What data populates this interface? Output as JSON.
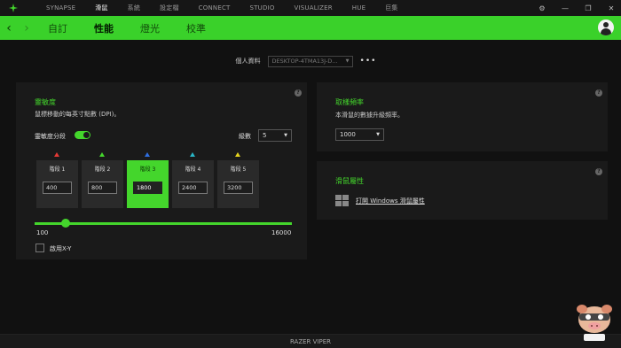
{
  "titlebar": {
    "nav": [
      "SYNAPSE",
      "滑鼠",
      "系統",
      "設定檔",
      "CONNECT",
      "STUDIO",
      "VISUALIZER",
      "HUE",
      "巨集"
    ],
    "active_index": 1
  },
  "subnav": {
    "tabs": [
      "自訂",
      "性能",
      "燈光",
      "校準"
    ],
    "active_index": 1
  },
  "profile": {
    "label": "個人資料",
    "value": "DESKTOP-4TMA13J-D...",
    "more": "•••"
  },
  "sensitivity": {
    "title": "靈敏度",
    "description": "鼠標移動的每英寸點數 (DPI)。",
    "stage_toggle_label": "靈敏度分段",
    "stage_toggle_on": true,
    "levels_label": "級數",
    "levels_value": "5",
    "stages": [
      {
        "name": "階段 1",
        "value": "400",
        "color": "#e53935"
      },
      {
        "name": "階段 2",
        "value": "800",
        "color": "#44d62c"
      },
      {
        "name": "階段 3",
        "value": "1800",
        "color": "#2f6fe0"
      },
      {
        "name": "階段 4",
        "value": "2400",
        "color": "#29b6c6"
      },
      {
        "name": "階段 5",
        "value": "3200",
        "color": "#e6d41e"
      }
    ],
    "active_stage": 2,
    "slider_min": "100",
    "slider_max": "16000",
    "xy_label": "啟用X-Y"
  },
  "polling": {
    "title": "取樣頻率",
    "description": "本滑鼠的數據升級頻率。",
    "value": "1000"
  },
  "mouse_properties": {
    "title": "滑鼠屬性",
    "link": "打開 Windows 滑鼠屬性"
  },
  "footer": {
    "device": "RAZER VIPER"
  },
  "colors": {
    "accent": "#44d62c",
    "background": "#111111",
    "panel": "#1a1a1a"
  }
}
